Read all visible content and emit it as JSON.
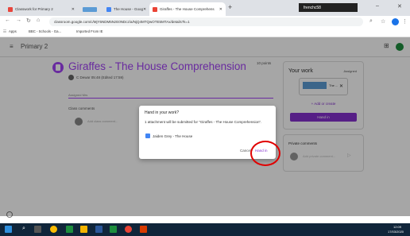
{
  "browser": {
    "tabs": [
      {
        "label": "Classwork for Primary 2",
        "favicon_color": "#fbbc04",
        "active": false
      },
      {
        "label": "",
        "favicon_color": "#5b9bd5",
        "active": false,
        "redacted": true
      },
      {
        "label": "The House - Goog",
        "favicon_color": "#4285f4",
        "active": false
      },
      {
        "label": "Giraffes - The House Comprehens",
        "favicon_color": "#ea4335",
        "active": true
      }
    ],
    "close_label": "✕",
    "new_tab_label": "+",
    "profile_name": "frenchc58",
    "window_controls": [
      "–",
      "✕"
    ],
    "url": "classroom.google.com/c/MjY5NDM5NzE0NDcz/a/NjQ4MTQwOTE5MTAx/details?k=1",
    "bookmarks": [
      "Apps",
      "BBC - Schools - Ga...",
      "Imported From IE"
    ]
  },
  "classroom": {
    "class_name": "Primary 2",
    "assignment": {
      "title": "Giraffes - The House Comprehension",
      "points": "10 points",
      "author_meta": "C Dewar  05:48 (Edited 17:59)",
      "due": "Assigned Mrs",
      "class_comments": "Class comments",
      "comment_placeholder": "Add class comment..."
    },
    "your_work": {
      "title": "Your work",
      "status": "Assigned",
      "attachment_name": "The ...",
      "add_create": "+ Add or create",
      "hand_in": "Hand in"
    },
    "private_comments": {
      "title": "Private comments",
      "placeholder": "Add private comment..."
    }
  },
  "dialog": {
    "title": "Hand in your work?",
    "message": "1 attachment will be submitted for \"Giraffes - The House Comprehension\".",
    "attachment": "Jaiden Grey - The House",
    "cancel": "Cancel",
    "confirm": "Hand in",
    "highlight_color": "#e00000"
  },
  "taskbar": {
    "time": "12:09",
    "date": "17/03/2020"
  }
}
